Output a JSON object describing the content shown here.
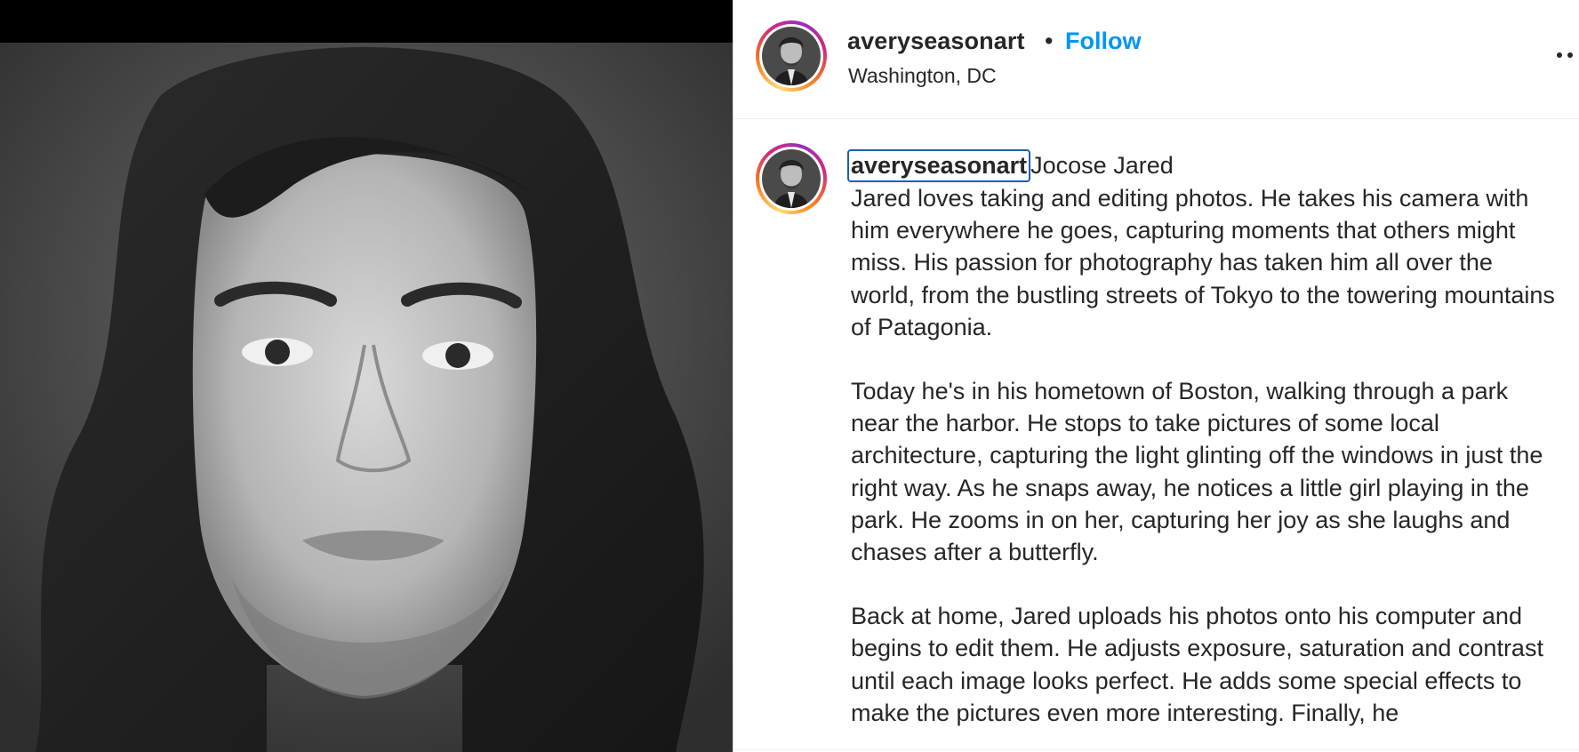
{
  "post": {
    "username": "averyseasonart",
    "separator": "•",
    "follow_label": "Follow",
    "location": "Washington, DC"
  },
  "icons": {
    "more": "more-options-icon",
    "avatar": "profile-avatar"
  },
  "colors": {
    "follow_blue": "#0095f6",
    "text": "#262626",
    "focus_outline": "#1a5fb4"
  },
  "caption": {
    "username": "averyseasonart",
    "title": "Jocose Jared",
    "paragraphs": [
      "Jared loves taking and editing photos. He takes his camera with him everywhere he goes, capturing moments that others might miss. His passion for photography has taken him all over the world, from the bustling streets of Tokyo to the towering mountains of Patagonia.",
      "Today he's in his hometown of Boston, walking through a park near the harbor. He stops to take pictures of some local architecture, capturing the light glinting off the windows in just the right way. As he snaps away, he notices a little girl playing in the park. He zooms in on her, capturing her joy as she laughs and chases after a butterfly.",
      "Back at home, Jared uploads his photos onto his computer and begins to edit them. He adjusts exposure, saturation and contrast until each image looks perfect. He adds some special effects to make the pictures even more interesting. Finally, he"
    ]
  }
}
